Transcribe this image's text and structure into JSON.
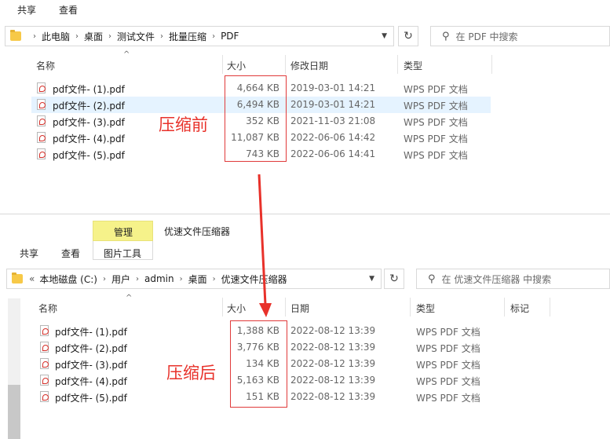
{
  "win1": {
    "tabs": [
      "共享",
      "查看"
    ],
    "breadcrumb": [
      "此电脑",
      "桌面",
      "测试文件",
      "批量压缩",
      "PDF"
    ],
    "search_placeholder": "在 PDF 中搜索",
    "columns": [
      "名称",
      "大小",
      "修改日期",
      "类型"
    ],
    "files": [
      {
        "name": "pdf文件- (1).pdf",
        "size": "4,664 KB",
        "date": "2019-03-01 14:21",
        "type": "WPS PDF 文档"
      },
      {
        "name": "pdf文件- (2).pdf",
        "size": "6,494 KB",
        "date": "2019-03-01 14:21",
        "type": "WPS PDF 文档"
      },
      {
        "name": "pdf文件- (3).pdf",
        "size": "352 KB",
        "date": "2021-11-03 21:08",
        "type": "WPS PDF 文档"
      },
      {
        "name": "pdf文件- (4).pdf",
        "size": "11,087 KB",
        "date": "2022-06-06 14:42",
        "type": "WPS PDF 文档"
      },
      {
        "name": "pdf文件- (5).pdf",
        "size": "743 KB",
        "date": "2022-06-06 14:41",
        "type": "WPS PDF 文档"
      }
    ],
    "annotation": "压缩前"
  },
  "win2": {
    "title": "优速文件压缩器",
    "manage_tab": "管理",
    "tabs": [
      "共享",
      "查看",
      "图片工具"
    ],
    "breadcrumb_prefix": "«",
    "breadcrumb": [
      "本地磁盘 (C:)",
      "用户",
      "admin",
      "桌面",
      "优速文件压缩器"
    ],
    "search_placeholder": "在 优速文件压缩器 中搜索",
    "columns": [
      "名称",
      "大小",
      "日期",
      "类型",
      "标记"
    ],
    "files": [
      {
        "name": "pdf文件- (1).pdf",
        "size": "1,388 KB",
        "date": "2022-08-12 13:39",
        "type": "WPS PDF 文档"
      },
      {
        "name": "pdf文件- (2).pdf",
        "size": "3,776 KB",
        "date": "2022-08-12 13:39",
        "type": "WPS PDF 文档"
      },
      {
        "name": "pdf文件- (3).pdf",
        "size": "134 KB",
        "date": "2022-08-12 13:39",
        "type": "WPS PDF 文档"
      },
      {
        "name": "pdf文件- (4).pdf",
        "size": "5,163 KB",
        "date": "2022-08-12 13:39",
        "type": "WPS PDF 文档"
      },
      {
        "name": "pdf文件- (5).pdf",
        "size": "151 KB",
        "date": "2022-08-12 13:39",
        "type": "WPS PDF 文档"
      }
    ],
    "annotation": "压缩后"
  },
  "colors": {
    "annotation_red": "#e8312a",
    "selected_row": "#e5f3ff",
    "manage_tab": "#f6f28a"
  }
}
